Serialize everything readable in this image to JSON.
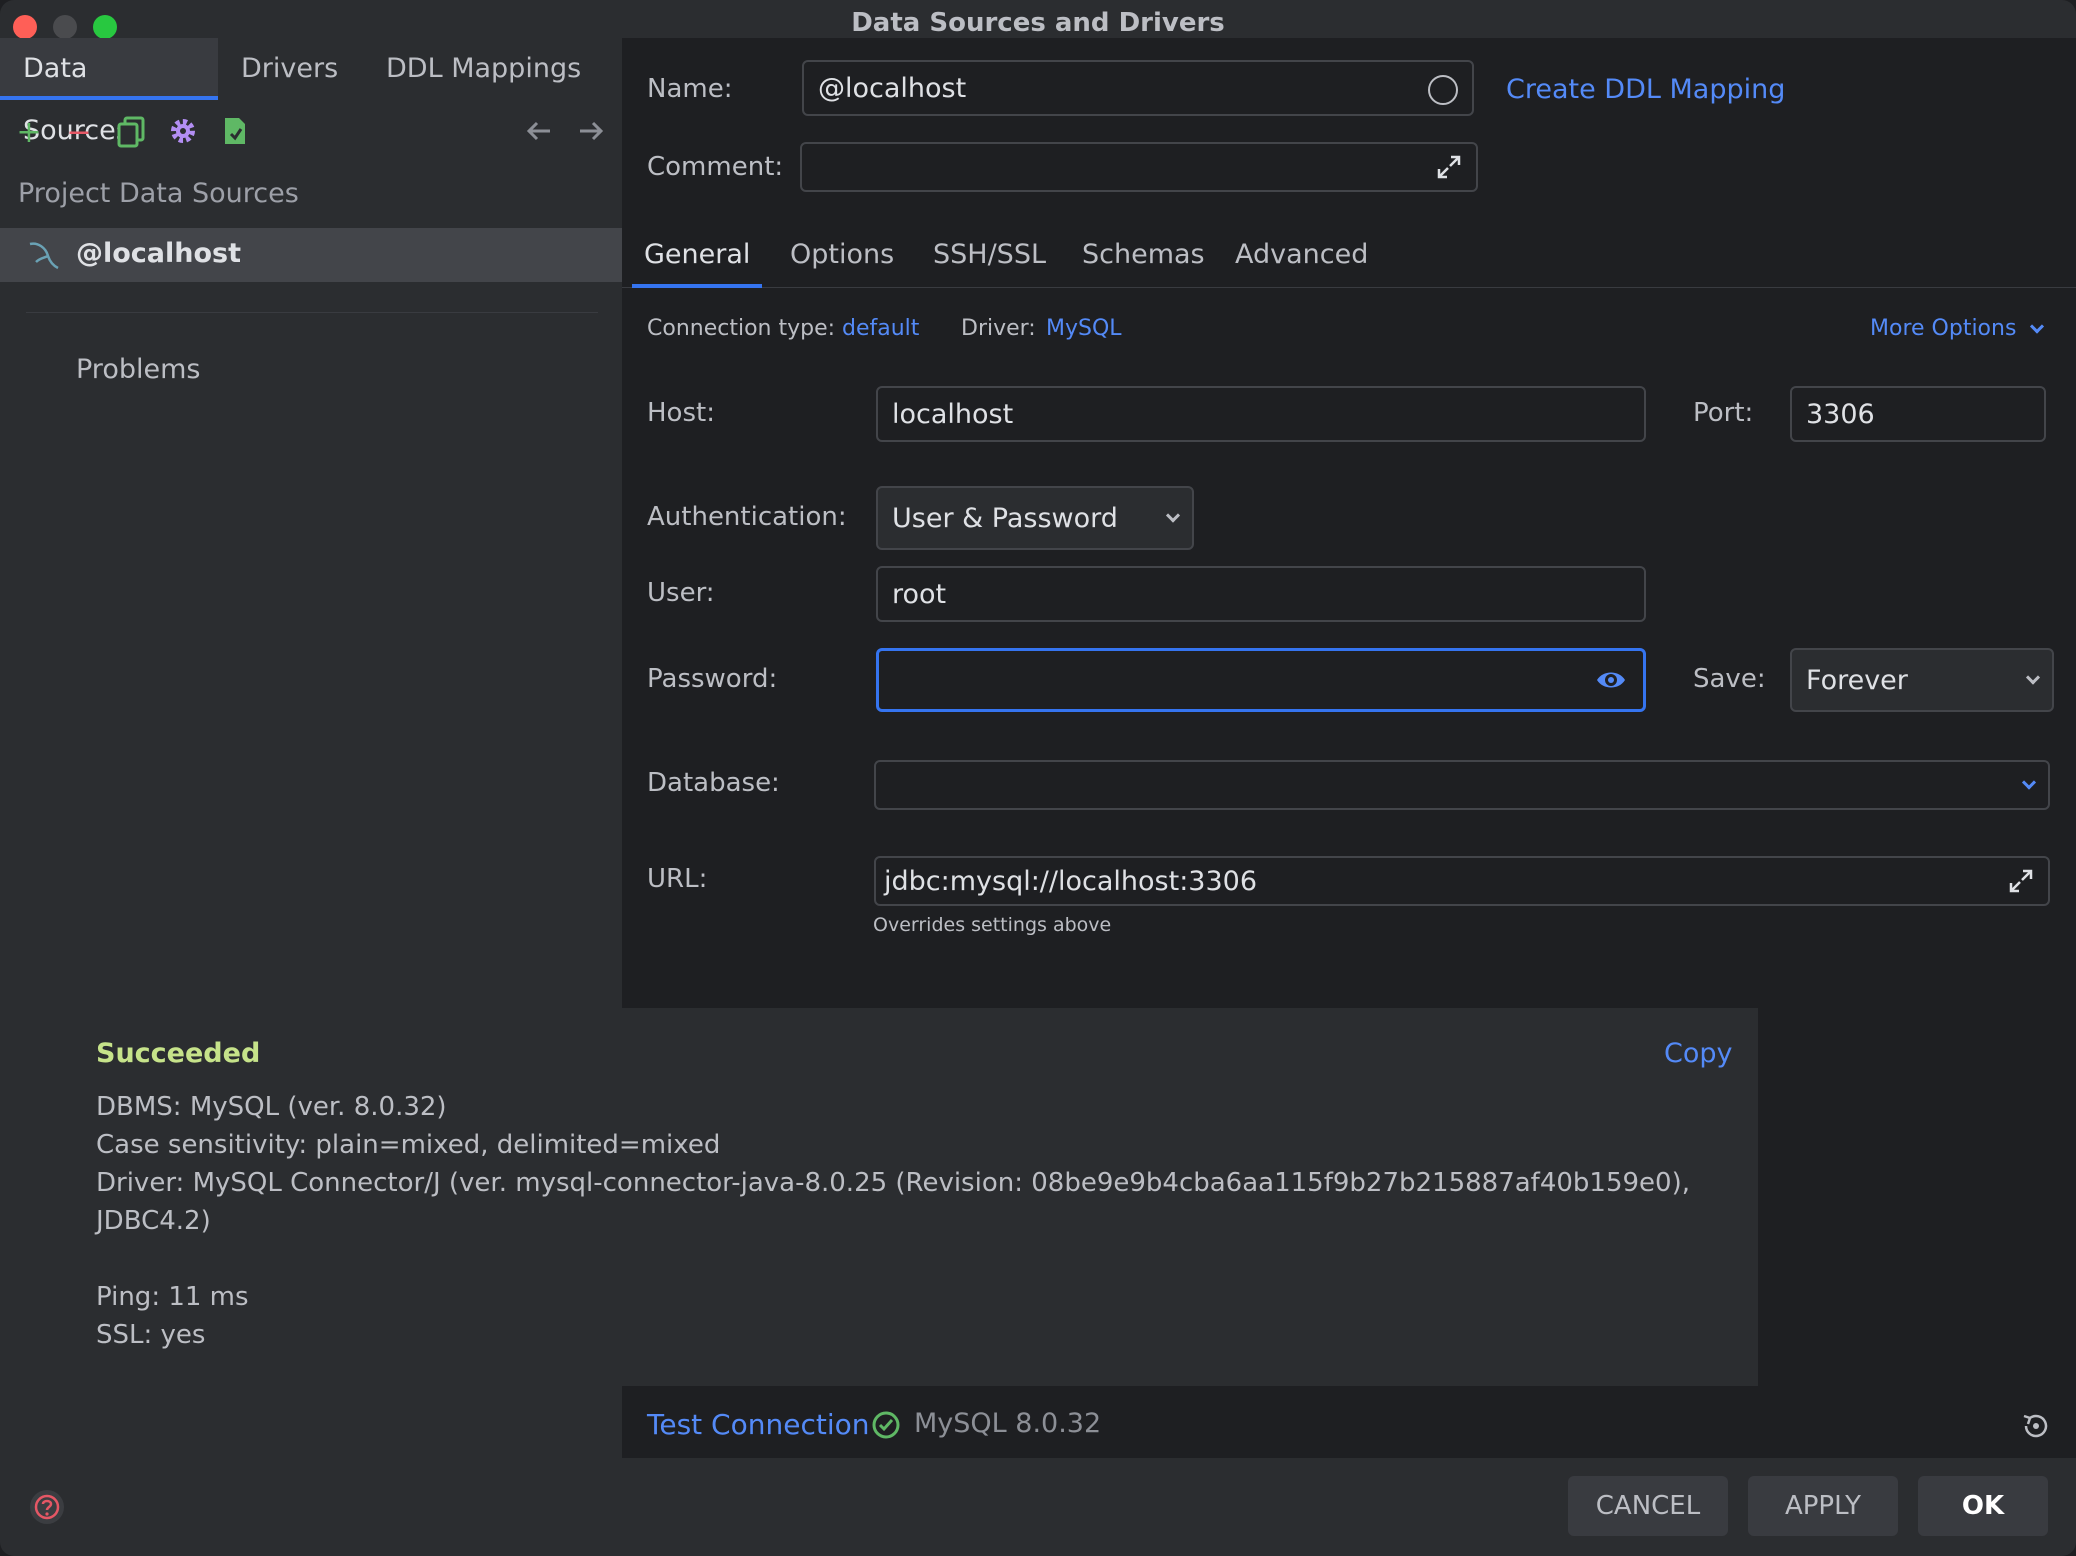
{
  "window": {
    "title": "Data Sources and Drivers"
  },
  "left_tabs": [
    "Data Sources",
    "Drivers",
    "DDL Mappings"
  ],
  "toolbar_icons": [
    "add-icon",
    "remove-icon",
    "duplicate-icon",
    "settings-icon",
    "import-icon",
    "back-arrow-icon",
    "forward-arrow-icon"
  ],
  "left": {
    "section_label": "Project Data Sources",
    "data_source": "@localhost",
    "problems": "Problems"
  },
  "form": {
    "name_label": "Name:",
    "name_value": "@localhost",
    "create_ddl_link": "Create DDL Mapping",
    "comment_label": "Comment:",
    "comment_value": ""
  },
  "tabs": [
    "General",
    "Options",
    "SSH/SSL",
    "Schemas",
    "Advanced"
  ],
  "general": {
    "conn_type_label": "Connection type:",
    "conn_type_value": "default",
    "driver_label": "Driver:",
    "driver_value": "MySQL",
    "more_options": "More Options",
    "host_label": "Host:",
    "host_value": "localhost",
    "port_label": "Port:",
    "port_value": "3306",
    "auth_label": "Authentication:",
    "auth_value": "User & Password",
    "user_label": "User:",
    "user_value": "root",
    "password_label": "Password:",
    "password_value": "",
    "save_label": "Save:",
    "save_value": "Forever",
    "database_label": "Database:",
    "database_value": "",
    "url_label": "URL:",
    "url_value": "jdbc:mysql://localhost:3306",
    "url_hint": "Overrides settings above"
  },
  "result": {
    "status": "Succeeded",
    "copy": "Copy",
    "lines": [
      "DBMS: MySQL (ver. 8.0.32)",
      "Case sensitivity: plain=mixed, delimited=mixed",
      "Driver: MySQL Connector/J (ver. mysql-connector-java-8.0.25 (Revision: 08be9e9b4cba6aa115f9b27b215887af40b159e0),",
      "JDBC4.2)",
      "Ping: 11 ms",
      "SSL: yes"
    ]
  },
  "footer": {
    "test_connection": "Test Connection",
    "db_version": "MySQL 8.0.32",
    "cancel": "CANCEL",
    "apply": "APPLY",
    "ok": "OK"
  },
  "colors": {
    "accent": "#3574f0",
    "link": "#548af7",
    "success": "#c6e38a",
    "close": "#ff5f57",
    "maximize": "#28c840"
  }
}
